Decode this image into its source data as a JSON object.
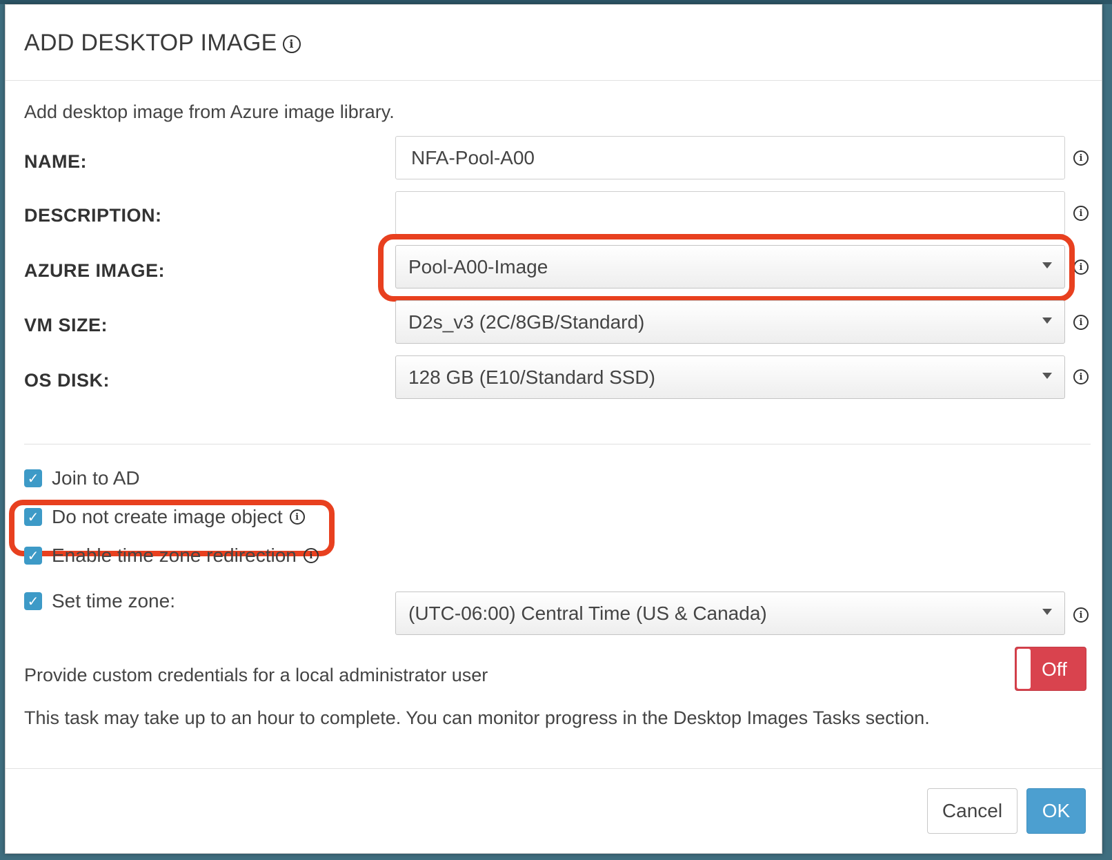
{
  "dialog": {
    "title": "ADD DESKTOP IMAGE",
    "intro": "Add desktop image from Azure image library."
  },
  "form": {
    "name": {
      "label": "NAME:",
      "value": "NFA-Pool-A00"
    },
    "description": {
      "label": "DESCRIPTION:",
      "value": ""
    },
    "azure_image": {
      "label": "AZURE IMAGE:",
      "value": "Pool-A00-Image"
    },
    "vm_size": {
      "label": "VM SIZE:",
      "value": "D2s_v3 (2C/8GB/Standard)"
    },
    "os_disk": {
      "label": "OS DISK:",
      "value": "128 GB (E10/Standard SSD)"
    }
  },
  "options": {
    "join_ad": {
      "label": "Join to AD",
      "checked": true
    },
    "no_image_object": {
      "label": "Do not create image object",
      "checked": true
    },
    "tz_redirect": {
      "label": "Enable time zone redirection",
      "checked": true
    },
    "set_tz": {
      "label": "Set time zone:",
      "checked": true,
      "value": "(UTC-06:00) Central Time (US & Canada)"
    }
  },
  "credentials": {
    "label": "Provide custom credentials for a local administrator user",
    "toggle": "Off"
  },
  "note": "This task may take up to an hour to complete. You can monitor progress in the Desktop Images Tasks section.",
  "buttons": {
    "cancel": "Cancel",
    "ok": "OK"
  },
  "icons": {
    "info": "info-icon",
    "check": "check-icon",
    "caret": "caret-down-icon"
  },
  "colors": {
    "highlight": "#e8401f",
    "checkbox": "#3d9ac7",
    "toggle_off": "#d9434e",
    "ok_button": "#4c9fd0"
  }
}
